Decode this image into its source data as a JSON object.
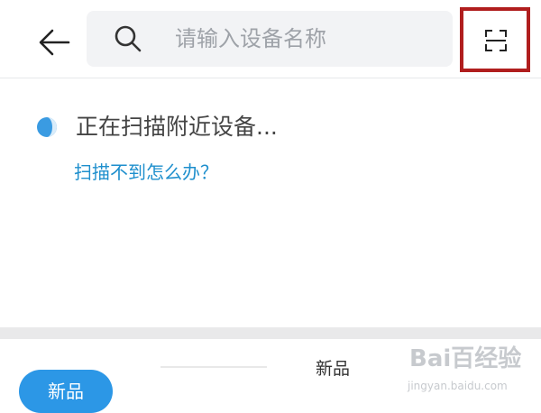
{
  "header": {
    "back_icon": "arrow-left-icon",
    "search": {
      "icon": "search-icon",
      "placeholder": "请输入设备名称"
    },
    "scan_icon": "scan-frame-icon",
    "highlight_color": "#b01e1e"
  },
  "scan": {
    "status_icon": "loading-icon",
    "status": "正在扫描附近设备...",
    "help_link": "扫描不到怎么办？",
    "link_color": "#1e8fcd"
  },
  "bottom": {
    "badge": "新品",
    "badge_color": "#2c97e6",
    "tab_label": "新品"
  },
  "watermark": {
    "logo": "Bai百经验",
    "url": "jingyan.baidu.com"
  }
}
